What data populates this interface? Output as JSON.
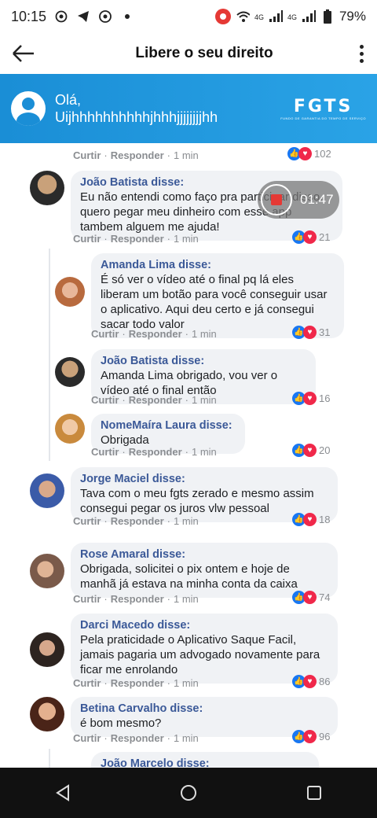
{
  "status_bar": {
    "time": "10:15",
    "battery": "79%",
    "signal_label_1": "4G",
    "signal_label_2": "4G"
  },
  "app_bar": {
    "title": "Libere o seu direito"
  },
  "banner": {
    "greeting": "Olá,",
    "username": "Uijhhhhhhhhhhjhhhjjjjjjjjhh",
    "logo_text": "FGTS",
    "logo_subtext": "FUNDO DE GARANTIA DO TEMPO DE SERVIÇO"
  },
  "video_overlay": {
    "time": "01:47"
  },
  "actions": {
    "like": "Curtir",
    "reply": "Responder",
    "time": "1 min"
  },
  "comments": [
    {
      "author": "",
      "text": "",
      "reactions": "102"
    },
    {
      "author": "João Batista disse:",
      "text": "Eu não entendi como faço pra participar disso, quero pegar meu dinheiro com esse app tambem alguem me ajuda!",
      "reactions": "21"
    },
    {
      "author": "Amanda Lima disse:",
      "text": "É só ver o vídeo até o final pq lá eles liberam um botão para você conseguir usar o aplicativo. Aqui deu certo e já consegui sacar todo valor",
      "reactions": "31"
    },
    {
      "author": "João Batista disse:",
      "text": "Amanda Lima obrigado, vou ver o vídeo até o final então",
      "reactions": "16"
    },
    {
      "author": "NomeMaíra Laura disse:",
      "text": "Obrigada",
      "reactions": "20"
    },
    {
      "author": "Jorge Maciel disse:",
      "text": "Tava com o meu fgts zerado e mesmo assim consegui pegar os juros vlw pessoal",
      "reactions": "18"
    },
    {
      "author": "Rose Amaral disse:",
      "text": "Obrigada, solicitei o pix ontem e hoje de manhã já estava na minha conta da caixa",
      "reactions": "74"
    },
    {
      "author": "Darci Macedo disse:",
      "text": "Pela praticidade o Aplicativo Saque Facil, jamais pagaria um advogado novamente para ficar me enrolando",
      "reactions": "86"
    },
    {
      "author": "Betina Carvalho disse:",
      "text": "é bom mesmo?",
      "reactions": "96"
    },
    {
      "author": "João Marcelo disse:",
      "text": "",
      "reactions": ""
    }
  ],
  "colors": {
    "banner": "#1a8ed6",
    "author": "#3b5998",
    "like": "#1877f2",
    "heart": "#f0284a"
  }
}
